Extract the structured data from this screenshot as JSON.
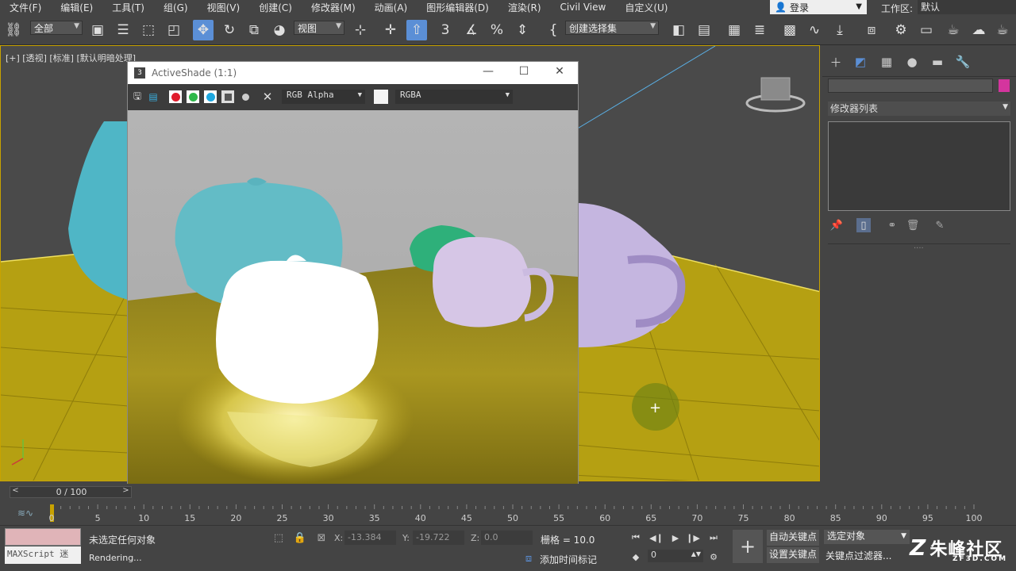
{
  "menubar": {
    "items": [
      "文件(F)",
      "编辑(E)",
      "工具(T)",
      "组(G)",
      "视图(V)",
      "创建(C)",
      "修改器(M)",
      "动画(A)",
      "图形编辑器(D)",
      "渲染(R)",
      "Civil View",
      "自定义(U)"
    ],
    "login_label": "登录",
    "workspace_label": "工作区:",
    "workspace_value": "默认"
  },
  "toolbar": {
    "selection_filter": "全部",
    "reference_coord": "视图",
    "named_selection": "创建选择集"
  },
  "viewport": {
    "label": "[+] [透视] [标准] [默认明暗处理]"
  },
  "activeshade": {
    "title": "ActiveShade (1:1)",
    "app_icon": "3",
    "channel": "RGB Alpha",
    "display_channel": "RGBA"
  },
  "command_panel": {
    "modifier_list": "修改器列表",
    "object_color": "#d4359e"
  },
  "trackbar": {
    "frame_readout": "0 / 100",
    "ticks": [
      "0",
      "5",
      "10",
      "15",
      "20",
      "25",
      "30",
      "35",
      "40",
      "45",
      "50",
      "55",
      "60",
      "65",
      "70",
      "75",
      "80",
      "85",
      "90",
      "95",
      "100"
    ]
  },
  "statusbar": {
    "maxscript_label": "MAXScript 迷",
    "selection_status": "未选定任何对象",
    "prompt": "Rendering...",
    "x_label": "X:",
    "x_value": "-13.384",
    "y_label": "Y:",
    "y_value": "-19.722",
    "z_label": "Z:",
    "z_value": "0.0",
    "grid": "栅格 = 10.0",
    "add_time_tag": "添加时间标记",
    "current_frame": "0",
    "auto_key": "自动关键点",
    "set_key": "设置关键点",
    "key_mode": "选定对象",
    "key_filters": "关键点过滤器..."
  },
  "watermark": {
    "brand": "朱峰社区",
    "domain": "ZF3D.COM"
  },
  "colors": {
    "accent": "#5b8fd6",
    "viewport_border": "#c8a200",
    "floor": "#b5a012"
  }
}
